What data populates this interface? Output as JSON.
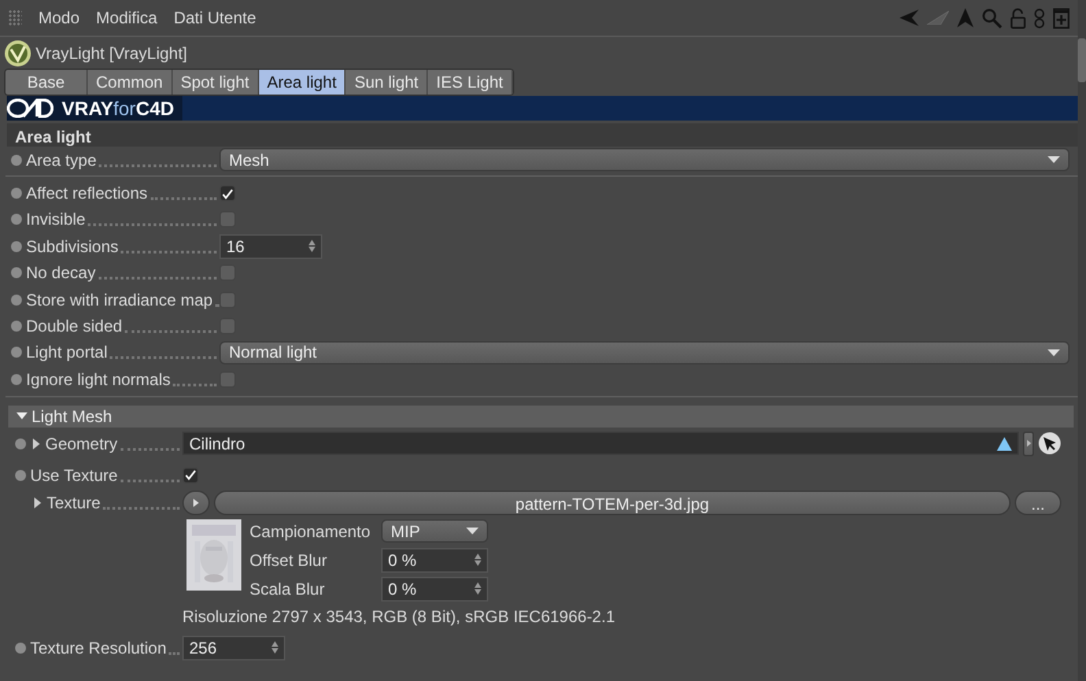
{
  "menu": [
    {
      "label": "Modo"
    },
    {
      "label": "Modifica"
    },
    {
      "label": "Dati Utente"
    }
  ],
  "object_title": "VrayLight [VrayLight]",
  "tabs": [
    {
      "label": "Base",
      "selected": false
    },
    {
      "label": "Common",
      "selected": false
    },
    {
      "label": "Spot light",
      "selected": false
    },
    {
      "label": "Area light",
      "selected": true
    },
    {
      "label": "Sun light",
      "selected": false
    },
    {
      "label": "IES Light",
      "selected": false
    }
  ],
  "banner": {
    "parts": [
      "VRAY",
      "for",
      "C4D"
    ]
  },
  "area_light": {
    "title": "Area light",
    "groups": [
      [
        {
          "label": "Area type",
          "kind": "dropdown",
          "value": "Mesh"
        }
      ],
      [
        {
          "label": "Affect reflections",
          "kind": "checkbox",
          "checked": true
        },
        {
          "label": "Invisible",
          "kind": "checkbox",
          "checked": false
        },
        {
          "label": "Subdivisions",
          "kind": "spinner",
          "value": "16"
        },
        {
          "label": "No decay",
          "kind": "checkbox",
          "checked": false
        },
        {
          "label": "Store with irradiance map",
          "kind": "checkbox",
          "checked": false
        },
        {
          "label": "Double sided",
          "kind": "checkbox",
          "checked": false
        },
        {
          "label": "Light portal",
          "kind": "dropdown",
          "value": "Normal light"
        },
        {
          "label": "Ignore light normals",
          "kind": "checkbox",
          "checked": false
        }
      ]
    ]
  },
  "light_mesh": {
    "title": "Light Mesh",
    "expanded": true,
    "rows": [
      {
        "label": "Geometry",
        "kind": "link",
        "keyframe_dot": true,
        "expander": true,
        "value": "Cilindro"
      },
      {
        "label": "Use Texture",
        "kind": "checkbox",
        "keyframe_dot": true,
        "expander": false,
        "checked": true
      },
      {
        "label": "Texture",
        "kind": "file",
        "keyframe_dot": false,
        "expander": true,
        "value": "pattern-TOTEM-per-3d.jpg",
        "browse": "..."
      },
      {
        "kind": "sampling",
        "fields": [
          {
            "label": "Campionamento",
            "kind": "dropdown",
            "value": "MIP"
          },
          {
            "label": "Offset Blur",
            "kind": "spinner",
            "value": "0 %"
          },
          {
            "label": "Scala Blur",
            "kind": "spinner",
            "value": "0 %"
          }
        ]
      },
      {
        "kind": "info",
        "text": "Risoluzione 2797 x 3543, RGB (8 Bit), sRGB IEC61966-2.1"
      },
      {
        "label": "Texture Resolution",
        "kind": "spinner",
        "keyframe_dot": true,
        "expander": false,
        "value": "256"
      }
    ]
  }
}
